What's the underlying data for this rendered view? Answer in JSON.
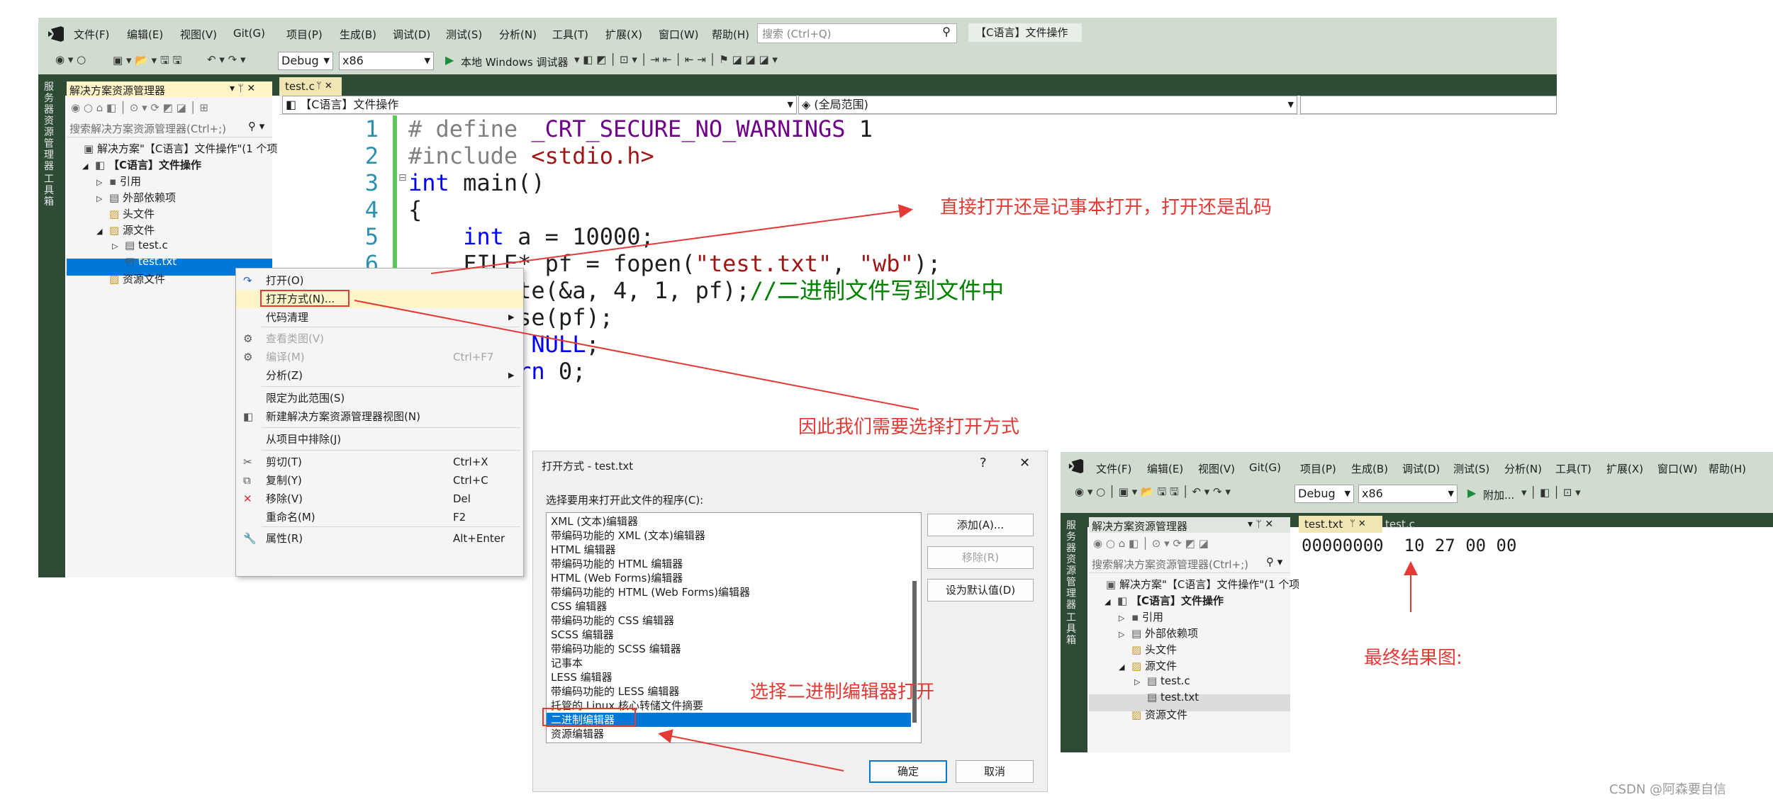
{
  "vs_main": {
    "menu": [
      "文件(F)",
      "编辑(E)",
      "视图(V)",
      "Git(G)",
      "项目(P)",
      "生成(B)",
      "调试(D)",
      "测试(S)",
      "分析(N)",
      "工具(T)",
      "扩展(X)",
      "窗口(W)",
      "帮助(H)"
    ],
    "search_placeholder": "搜索 (Ctrl+Q)",
    "solution_title": "【C语言】文件操作",
    "config": "Debug",
    "platform": "x86",
    "run_label": "本地 Windows 调试器",
    "side_tabs": [
      "服务器资源管理器",
      "工具箱"
    ],
    "explorer": {
      "title": "解决方案资源管理器",
      "search_placeholder": "搜索解决方案资源管理器(Ctrl+;)",
      "items": [
        "解决方案\"【C语言】文件操作\"(1 个项",
        "【C语言】文件操作",
        "引用",
        "外部依赖项",
        "头文件",
        "源文件",
        "test.c",
        "test.txt",
        "资源文件"
      ]
    },
    "editor": {
      "tab": "test.c",
      "scope_left": "【C语言】文件操作",
      "scope_right": "(全局范围)",
      "line_numbers": [
        "1",
        "2",
        "3",
        "4",
        "5",
        "6"
      ]
    }
  },
  "context_menu": {
    "items": [
      {
        "label": "打开(O)",
        "shortcut": ""
      },
      {
        "label": "打开方式(N)...",
        "shortcut": ""
      },
      {
        "label": "代码清理",
        "shortcut": ""
      },
      {
        "label": "查看类图(V)",
        "shortcut": ""
      },
      {
        "label": "编译(M)",
        "shortcut": "Ctrl+F7"
      },
      {
        "label": "分析(Z)",
        "shortcut": ""
      },
      {
        "label": "限定为此范围(S)",
        "shortcut": ""
      },
      {
        "label": "新建解决方案资源管理器视图(N)",
        "shortcut": ""
      },
      {
        "label": "从项目中排除(J)",
        "shortcut": ""
      },
      {
        "label": "剪切(T)",
        "shortcut": "Ctrl+X"
      },
      {
        "label": "复制(Y)",
        "shortcut": "Ctrl+C"
      },
      {
        "label": "移除(V)",
        "shortcut": "Del"
      },
      {
        "label": "重命名(M)",
        "shortcut": "F2"
      },
      {
        "label": "属性(R)",
        "shortcut": "Alt+Enter"
      }
    ]
  },
  "dialog": {
    "title": "打开方式 - test.txt",
    "help": "?",
    "close": "✕",
    "prompt": "选择要用来打开此文件的程序(C):",
    "programs": [
      "XML (文本)编辑器",
      "带编码功能的 XML (文本)编辑器",
      "HTML 编辑器",
      "带编码功能的 HTML 编辑器",
      "HTML (Web Forms)编辑器",
      "带编码功能的 HTML (Web Forms)编辑器",
      "CSS 编辑器",
      "带编码功能的 CSS 编辑器",
      "SCSS 编辑器",
      "带编码功能的 SCSS 编辑器",
      "记事本",
      "LESS 编辑器",
      "带编码功能的 LESS 编辑器",
      "托管的 Linux 核心转储文件摘要",
      "二进制编辑器",
      "资源编辑器"
    ],
    "add": "添加(A)...",
    "remove": "移除(R)",
    "set_default": "设为默认值(D)",
    "ok": "确定",
    "cancel": "取消"
  },
  "vs_second": {
    "menu": [
      "文件(F)",
      "编辑(E)",
      "视图(V)",
      "Git(G)",
      "项目(P)",
      "生成(B)",
      "调试(D)",
      "测试(S)",
      "分析(N)",
      "工具(T)",
      "扩展(X)",
      "窗口(W)",
      "帮助(H)"
    ],
    "config": "Debug",
    "platform": "x86",
    "attach": "附加...",
    "explorer_title": "解决方案资源管理器",
    "search_placeholder": "搜索解决方案资源管理器(Ctrl+;)",
    "items": [
      "解决方案\"【C语言】文件操作\"(1 个项",
      "【C语言】文件操作",
      "引用",
      "外部依赖项",
      "头文件",
      "源文件",
      "test.c",
      "test.txt",
      "资源文件"
    ],
    "tabs": [
      "test.txt",
      "test.c"
    ],
    "hex_line": "00000000  10 27 00 00"
  },
  "annotations": {
    "a1": "直接打开还是记事本打开，打开还是乱码",
    "a2": "因此我们需要选择打开方式",
    "a3": "选择二进制编辑器打开",
    "a4": "最终结果图:"
  },
  "watermark": "CSDN @阿森要自信",
  "colors": {
    "accent": "#0078d7",
    "annotation": "#e53935",
    "band": "#2e4b36",
    "titlebar": "#cfdccf"
  }
}
